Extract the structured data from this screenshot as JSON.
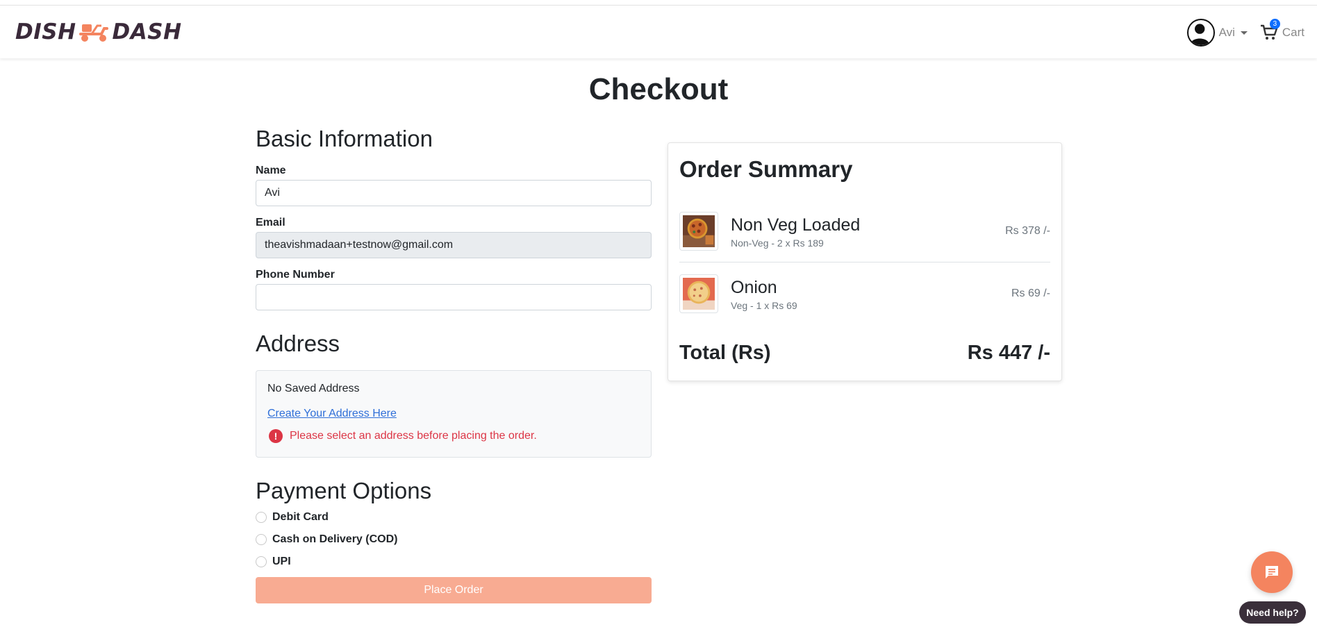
{
  "brand": {
    "logo_left": "DISH",
    "logo_right": "DASH",
    "accent": "#f4845f",
    "dark": "#3a2a3a"
  },
  "nav": {
    "user_name": "Avi",
    "cart_count": "3",
    "cart_label": "Cart"
  },
  "page": {
    "title": "Checkout"
  },
  "basic_info": {
    "heading": "Basic Information",
    "name_label": "Name",
    "name_value": "Avi",
    "email_label": "Email",
    "email_value": "theavishmadaan+testnow@gmail.com",
    "phone_label": "Phone Number",
    "phone_value": ""
  },
  "address": {
    "heading": "Address",
    "empty_text": "No Saved Address",
    "create_link": "Create Your Address Here",
    "error_text": "Please select an address before placing the order."
  },
  "payment": {
    "heading": "Payment Options",
    "options": [
      "Debit Card",
      "Cash on Delivery (COD)",
      "UPI"
    ],
    "place_order": "Place Order"
  },
  "summary": {
    "title": "Order Summary",
    "items": [
      {
        "name": "Non Veg Loaded",
        "meta": "Non-Veg - 2 x Rs 189",
        "price": "Rs 378 /-"
      },
      {
        "name": "Onion",
        "meta": "Veg - 1 x Rs 69",
        "price": "Rs 69 /-"
      }
    ],
    "total_label": "Total (Rs)",
    "total_value": "Rs 447 /-"
  },
  "help": {
    "label": "Need help?"
  }
}
